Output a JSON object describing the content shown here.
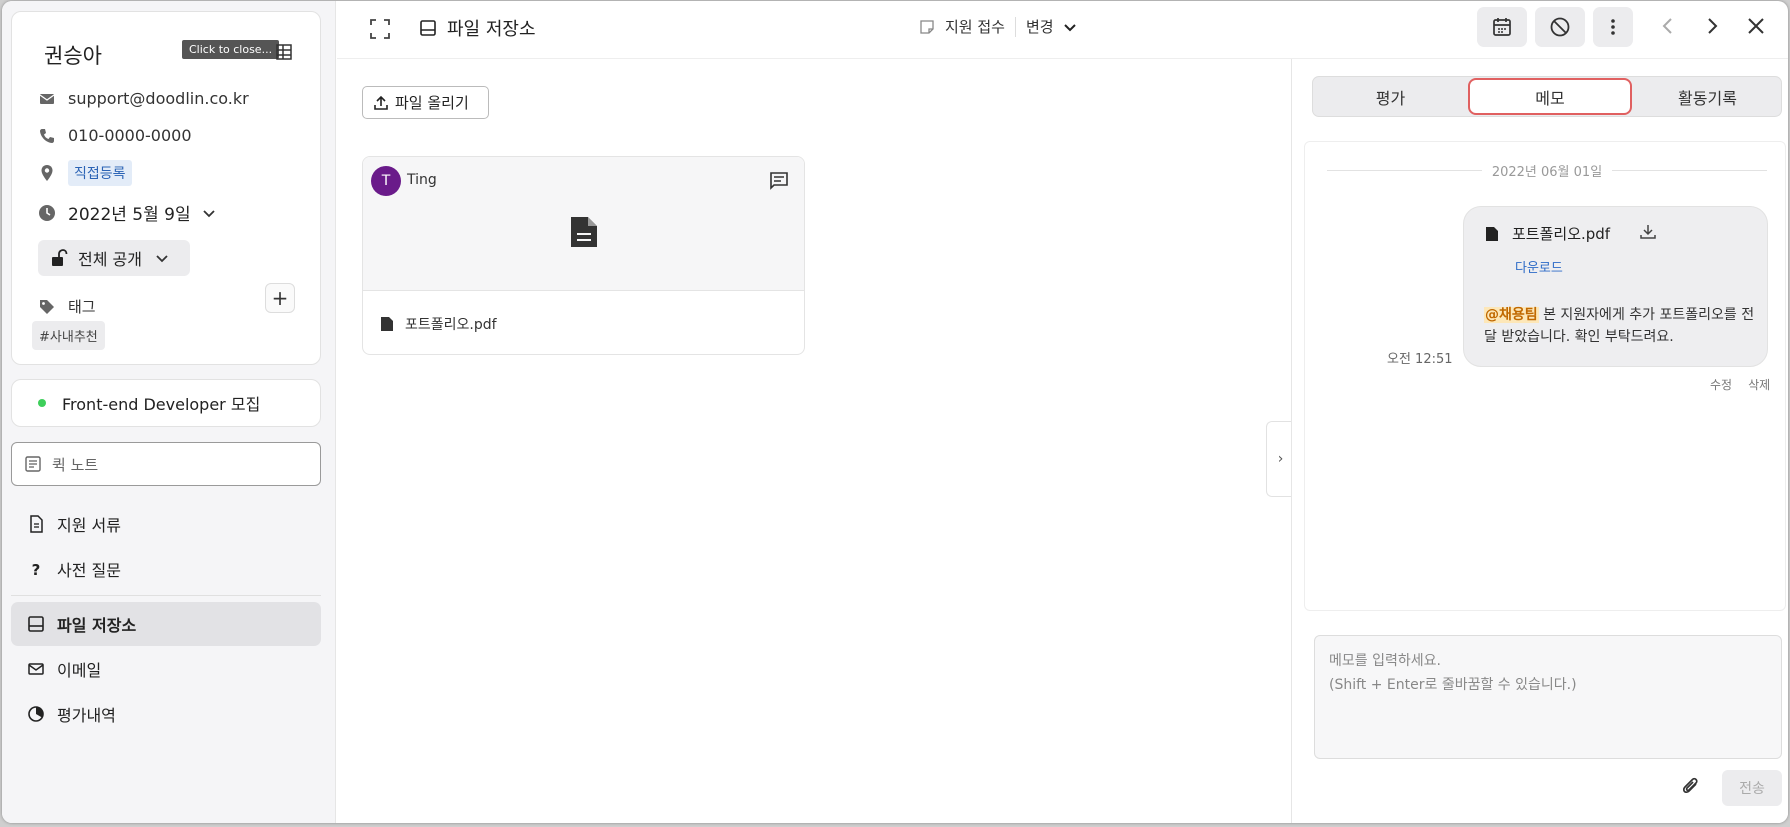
{
  "candidate": {
    "name": "권승아",
    "tooltip": "Click to close...",
    "email": "support@doodlin.co.kr",
    "phone": "010-0000-0000",
    "location_chip": "직접등록",
    "date": "2022년 5월 9일",
    "visibility": "전체 공개",
    "tags_label": "태그",
    "add_label": "+",
    "tag": "#사내추천"
  },
  "job": {
    "title": "Front-end Developer 모집",
    "status_color": "#3ecf5b"
  },
  "quick_note": {
    "placeholder": "퀵 노트"
  },
  "nav": {
    "items": [
      {
        "label": "지원 서류",
        "icon": "document-icon"
      },
      {
        "label": "사전 질문",
        "icon": "question-icon"
      },
      {
        "label": "파일 저장소",
        "icon": "storage-icon",
        "active": true
      },
      {
        "label": "이메일",
        "icon": "mail-icon"
      },
      {
        "label": "평가내역",
        "icon": "chart-icon"
      }
    ]
  },
  "header": {
    "title": "파일 저장소",
    "stage": "지원 접수",
    "change_label": "변경"
  },
  "files": {
    "upload_label": "파일 올리기",
    "items": [
      {
        "uploader_initial": "T",
        "uploader": "Ting",
        "name": "포트폴리오.pdf"
      }
    ]
  },
  "collapse": {
    "label": "›"
  },
  "right_panel": {
    "tabs": [
      {
        "label": "평가"
      },
      {
        "label": "메모",
        "active": true
      },
      {
        "label": "활동기록"
      }
    ],
    "memo_date": "2022년 06월 01일",
    "memo": {
      "attachment": "포트폴리오.pdf",
      "download_label": "다운로드",
      "mention": "@채용팀",
      "message": " 본 지원자에게 추가 포트폴리오를 전달 받았습니다. 확인 부탁드려요.",
      "time": "오전 12:51",
      "edit_label": "수정",
      "delete_label": "삭제"
    },
    "input": {
      "line1": "메모를 입력하세요.",
      "line2": "(Shift + Enter로 줄바꿈할 수 있습니다.)"
    },
    "send_label": "전송"
  },
  "colors": {
    "accent_red": "#e06060",
    "link_blue": "#2d6bc7",
    "avatar_purple": "#6a1b8a"
  }
}
